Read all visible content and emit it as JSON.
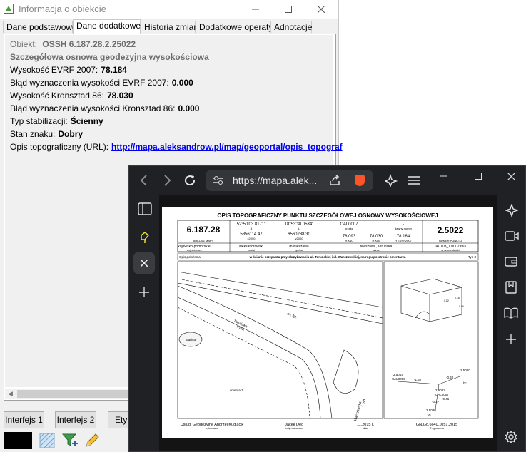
{
  "window": {
    "title": "Informacja o obiekcie"
  },
  "tabs": [
    {
      "label": "Dane podstawowe",
      "active": false
    },
    {
      "label": "Dane dodatkowe",
      "active": true
    },
    {
      "label": "Historia zmian",
      "active": false
    },
    {
      "label": "Dodatkowe operaty",
      "active": false
    },
    {
      "label": "Adnotacje",
      "active": false
    }
  ],
  "details": {
    "obiekt_label": "Obiekt:",
    "obiekt_value": "OSSH 6.187.28.2.25022",
    "heading": "Szczegółowa osnowa geodezyjna wysokościowa",
    "wys_evrf_label": "Wysokość EVRF 2007:",
    "wys_evrf_value": "78.184",
    "blad_evrf_label": "Błąd wyznaczenia wysokości EVRF 2007:",
    "blad_evrf_value": "0.000",
    "wys_kron_label": "Wysokość Kronsztad 86:",
    "wys_kron_value": "78.030",
    "blad_kron_label": "Błąd wyznaczenia wysokości Kronsztad 86:",
    "blad_kron_value": "0.000",
    "typ_label": "Typ stabilizacji:",
    "typ_value": "Ścienny",
    "stan_label": "Stan znaku:",
    "stan_value": "Dobry",
    "opis_label": "Opis topograficzny (URL):",
    "opis_url": "http://mapa.aleksandrow.pl/map/geoportal/opis_topograf"
  },
  "bottom_buttons": {
    "interfejs1": "Interfejs 1",
    "interfejs2": "Interfejs 2",
    "etyk": "Etyk"
  },
  "browser": {
    "url": "https://mapa.alek..."
  },
  "pdf": {
    "title": "OPIS TOPOGRAFICZNY PUNKTU SZCZEGÓŁOWEJ OSNOWY WYSOKOŚCIOWEJ",
    "number": "6.187.28",
    "arkusz_label": "ARKUSZ MAPY",
    "lat": "52°50'03.8171\"",
    "lat_sub": "B",
    "lon": "18°53'38.0534\"",
    "lon_sub": "L",
    "x": "5856114.47",
    "x_sub": "x2000",
    "y": "6560238.30",
    "y_sub": "y2000",
    "cal": "CAL0007",
    "orzeka": "orzeka",
    "h1": "78.093",
    "h1_sub": "H K60",
    "h2": "78.030",
    "h2_sub": "H K86",
    "dawny_label": "dawny numer",
    "dash": "-",
    "h3": "78.184",
    "h3_sub": "H EVRF2007",
    "point": "2.5022",
    "point_label": "NUMER PUNKTU",
    "woj": "kujawsko-pomorskie",
    "woj_sub": "województwo",
    "pow": "aleksandrowski",
    "pow_sub": "powiat",
    "gm": "m.Nieszawa",
    "gm_sub": "gmina",
    "adres": "Nieszawa, Toruńska",
    "adres_sub": "adres",
    "dzialka": "040103_1.0002.665",
    "dzialka_sub": "nr arkusz działki",
    "opis_label": "Opis położenia:",
    "opis_text": "w ścianie przepustu przy skrzyżowaniu ul. Toruńskiej i ul. Warszawskiej, na rogu po stronie cmentarza",
    "typ": "Typ 3",
    "street1": "Toruńska",
    "street1b": "/. mb.",
    "street2": "Warszawska",
    "street2b": "/. mb.",
    "road_label": "ch. kp.",
    "kaplica": "kaplica",
    "cmentarz": "cmentarz",
    "sk1": "2.5014",
    "sk1b": "CAL0085",
    "sk2": "2.5020",
    "sk2b": "bc",
    "sk3": "2.5022",
    "sk3b": "CAL0007",
    "sk4": "2.5030",
    "sk4b": "bc",
    "d1": "-1.52",
    "d2": "-0.40",
    "d3": "-0.27",
    "d4": "-0.46",
    "small1": "0.12",
    "small2": "0.16",
    "small3": "0.16",
    "footer_company": "Usługi Geodezyjne Andrzej Kudlacik",
    "footer_company_sub": "wykonawca",
    "footer_person": "Jacek Dec",
    "footer_person_sub": "imię i nazwisko",
    "footer_date": "11.2015 r.",
    "footer_date_sub": "data",
    "footer_ref": "GN.Go.6640.1051.2015",
    "footer_ref_sub": "© zgłoszenia"
  }
}
